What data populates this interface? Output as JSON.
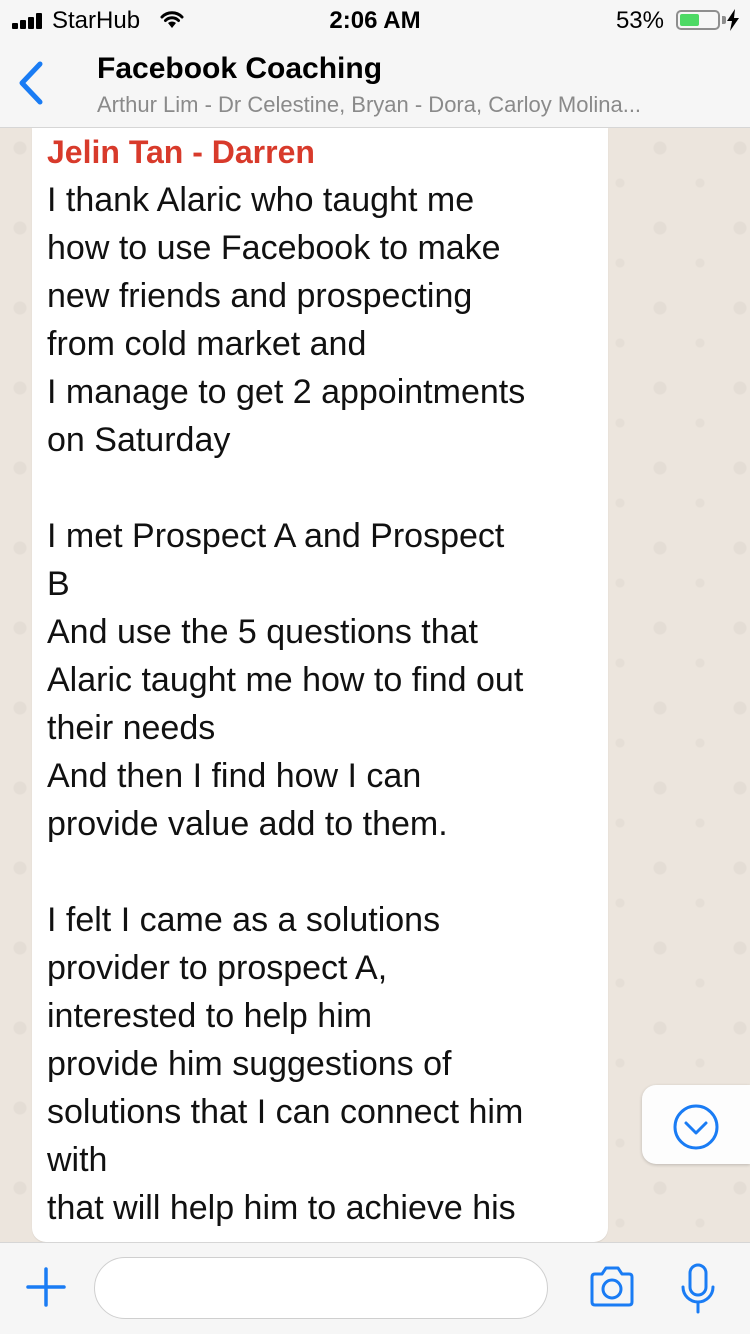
{
  "status_bar": {
    "carrier": "StarHub",
    "time": "2:06 AM",
    "battery_percent": "53%",
    "battery_level": 0.53,
    "icons": [
      "signal-icon",
      "wifi-icon",
      "battery-icon",
      "charging-bolt-icon"
    ]
  },
  "header": {
    "title": "Facebook Coaching",
    "subtitle": "Arthur Lim - Dr Celestine, Bryan - Dora, Carloy Molina...",
    "back_icon": "chevron-left-icon"
  },
  "message": {
    "sender": "Jelin Tan - Darren",
    "sender_color": "#d83a2b",
    "text": "I thank Alaric who taught me\nhow to use Facebook to make\nnew friends and prospecting\nfrom cold market and\nI manage to get 2 appointments\non Saturday\n\nI met Prospect A and Prospect\nB\nAnd use the 5 questions  that\nAlaric taught me how to find out\ntheir needs\nAnd then I find how I can\nprovide value add to them.\n\nI felt I came as a solutions\nprovider to prospect A,\ninterested to help him\nprovide him suggestions of\nsolutions that I can connect him\nwith\nthat will help him to achieve his"
  },
  "scroll_button": {
    "icon": "chevron-down-circle-icon"
  },
  "input_bar": {
    "placeholder": "",
    "icons": [
      "plus-icon",
      "camera-icon",
      "microphone-icon"
    ]
  },
  "colors": {
    "accent": "#1a7cf4",
    "bar_background": "#f6f6f6",
    "chat_background": "#ece5dd"
  }
}
